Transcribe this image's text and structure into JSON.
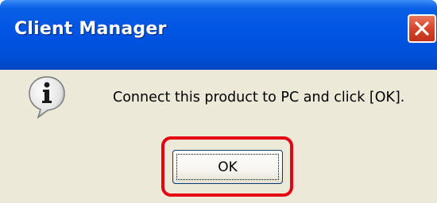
{
  "window": {
    "title": "Client Manager",
    "close_icon": "close-icon"
  },
  "dialog": {
    "icon": "info-icon",
    "message": "Connect this product to PC and click [OK].",
    "ok_label": "OK"
  },
  "colors": {
    "titlebar": "#0054e3",
    "dialog_background": "#ece9d8",
    "highlight": "#e50012",
    "close_button": "#d6452b"
  }
}
